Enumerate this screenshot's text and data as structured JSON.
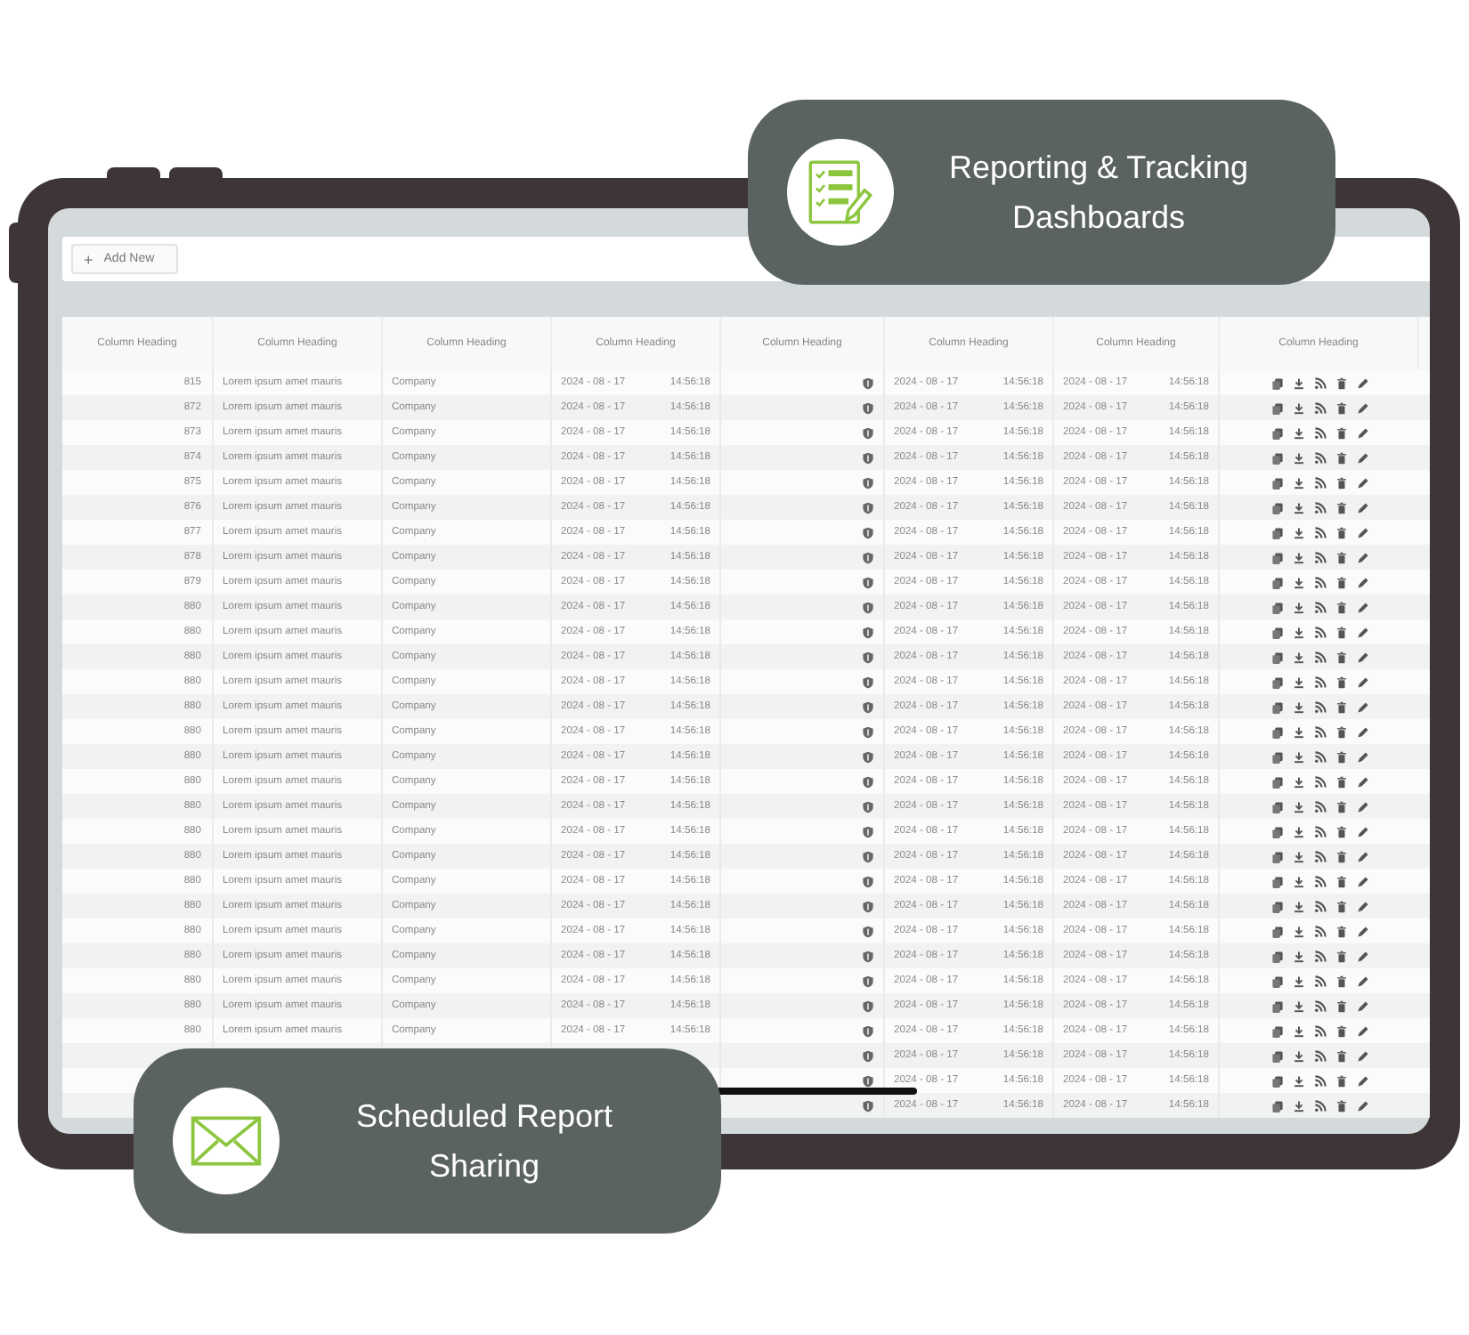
{
  "toolbar": {
    "add_button": {
      "icon": "+",
      "label": "Add New"
    }
  },
  "table": {
    "columns": [
      "Column Heading",
      "Column Heading",
      "Column Heading",
      "Column Heading",
      "Column Heading",
      "Column Heading",
      "Column Heading",
      "Column Heading"
    ],
    "rows": [
      {
        "number": "815",
        "description": "Lorem ipsum amet mauris",
        "company": "Company",
        "date_1": "2024 - 08 - 17",
        "time_1": "14:56:18",
        "date_2": "2024 - 08 - 17",
        "time_2": "14:56:18",
        "date_3": "2024 - 08 - 17",
        "time_3": "14:56:18"
      },
      {
        "number": "872",
        "description": "Lorem ipsum amet mauris",
        "company": "Company",
        "date_1": "2024 - 08 - 17",
        "time_1": "14:56:18",
        "date_2": "2024 - 08 - 17",
        "time_2": "14:56:18",
        "date_3": "2024 - 08 - 17",
        "time_3": "14:56:18"
      },
      {
        "number": "873",
        "description": "Lorem ipsum amet mauris",
        "company": "Company",
        "date_1": "2024 - 08 - 17",
        "time_1": "14:56:18",
        "date_2": "2024 - 08 - 17",
        "time_2": "14:56:18",
        "date_3": "2024 - 08 - 17",
        "time_3": "14:56:18"
      },
      {
        "number": "874",
        "description": "Lorem ipsum amet mauris",
        "company": "Company",
        "date_1": "2024 - 08 - 17",
        "time_1": "14:56:18",
        "date_2": "2024 - 08 - 17",
        "time_2": "14:56:18",
        "date_3": "2024 - 08 - 17",
        "time_3": "14:56:18"
      },
      {
        "number": "875",
        "description": "Lorem ipsum amet mauris",
        "company": "Company",
        "date_1": "2024 - 08 - 17",
        "time_1": "14:56:18",
        "date_2": "2024 - 08 - 17",
        "time_2": "14:56:18",
        "date_3": "2024 - 08 - 17",
        "time_3": "14:56:18"
      },
      {
        "number": "876",
        "description": "Lorem ipsum amet mauris",
        "company": "Company",
        "date_1": "2024 - 08 - 17",
        "time_1": "14:56:18",
        "date_2": "2024 - 08 - 17",
        "time_2": "14:56:18",
        "date_3": "2024 - 08 - 17",
        "time_3": "14:56:18"
      },
      {
        "number": "877",
        "description": "Lorem ipsum amet mauris",
        "company": "Company",
        "date_1": "2024 - 08 - 17",
        "time_1": "14:56:18",
        "date_2": "2024 - 08 - 17",
        "time_2": "14:56:18",
        "date_3": "2024 - 08 - 17",
        "time_3": "14:56:18"
      },
      {
        "number": "878",
        "description": "Lorem ipsum amet mauris",
        "company": "Company",
        "date_1": "2024 - 08 - 17",
        "time_1": "14:56:18",
        "date_2": "2024 - 08 - 17",
        "time_2": "14:56:18",
        "date_3": "2024 - 08 - 17",
        "time_3": "14:56:18"
      },
      {
        "number": "879",
        "description": "Lorem ipsum amet mauris",
        "company": "Company",
        "date_1": "2024 - 08 - 17",
        "time_1": "14:56:18",
        "date_2": "2024 - 08 - 17",
        "time_2": "14:56:18",
        "date_3": "2024 - 08 - 17",
        "time_3": "14:56:18"
      },
      {
        "number": "880",
        "description": "Lorem ipsum amet mauris",
        "company": "Company",
        "date_1": "2024 - 08 - 17",
        "time_1": "14:56:18",
        "date_2": "2024 - 08 - 17",
        "time_2": "14:56:18",
        "date_3": "2024 - 08 - 17",
        "time_3": "14:56:18"
      },
      {
        "number": "880",
        "description": "Lorem ipsum amet mauris",
        "company": "Company",
        "date_1": "2024 - 08 - 17",
        "time_1": "14:56:18",
        "date_2": "2024 - 08 - 17",
        "time_2": "14:56:18",
        "date_3": "2024 - 08 - 17",
        "time_3": "14:56:18"
      },
      {
        "number": "880",
        "description": "Lorem ipsum amet mauris",
        "company": "Company",
        "date_1": "2024 - 08 - 17",
        "time_1": "14:56:18",
        "date_2": "2024 - 08 - 17",
        "time_2": "14:56:18",
        "date_3": "2024 - 08 - 17",
        "time_3": "14:56:18"
      },
      {
        "number": "880",
        "description": "Lorem ipsum amet mauris",
        "company": "Company",
        "date_1": "2024 - 08 - 17",
        "time_1": "14:56:18",
        "date_2": "2024 - 08 - 17",
        "time_2": "14:56:18",
        "date_3": "2024 - 08 - 17",
        "time_3": "14:56:18"
      },
      {
        "number": "880",
        "description": "Lorem ipsum amet mauris",
        "company": "Company",
        "date_1": "2024 - 08 - 17",
        "time_1": "14:56:18",
        "date_2": "2024 - 08 - 17",
        "time_2": "14:56:18",
        "date_3": "2024 - 08 - 17",
        "time_3": "14:56:18"
      },
      {
        "number": "880",
        "description": "Lorem ipsum amet mauris",
        "company": "Company",
        "date_1": "2024 - 08 - 17",
        "time_1": "14:56:18",
        "date_2": "2024 - 08 - 17",
        "time_2": "14:56:18",
        "date_3": "2024 - 08 - 17",
        "time_3": "14:56:18"
      },
      {
        "number": "880",
        "description": "Lorem ipsum amet mauris",
        "company": "Company",
        "date_1": "2024 - 08 - 17",
        "time_1": "14:56:18",
        "date_2": "2024 - 08 - 17",
        "time_2": "14:56:18",
        "date_3": "2024 - 08 - 17",
        "time_3": "14:56:18"
      },
      {
        "number": "880",
        "description": "Lorem ipsum amet mauris",
        "company": "Company",
        "date_1": "2024 - 08 - 17",
        "time_1": "14:56:18",
        "date_2": "2024 - 08 - 17",
        "time_2": "14:56:18",
        "date_3": "2024 - 08 - 17",
        "time_3": "14:56:18"
      },
      {
        "number": "880",
        "description": "Lorem ipsum amet mauris",
        "company": "Company",
        "date_1": "2024 - 08 - 17",
        "time_1": "14:56:18",
        "date_2": "2024 - 08 - 17",
        "time_2": "14:56:18",
        "date_3": "2024 - 08 - 17",
        "time_3": "14:56:18"
      },
      {
        "number": "880",
        "description": "Lorem ipsum amet mauris",
        "company": "Company",
        "date_1": "2024 - 08 - 17",
        "time_1": "14:56:18",
        "date_2": "2024 - 08 - 17",
        "time_2": "14:56:18",
        "date_3": "2024 - 08 - 17",
        "time_3": "14:56:18"
      },
      {
        "number": "880",
        "description": "Lorem ipsum amet mauris",
        "company": "Company",
        "date_1": "2024 - 08 - 17",
        "time_1": "14:56:18",
        "date_2": "2024 - 08 - 17",
        "time_2": "14:56:18",
        "date_3": "2024 - 08 - 17",
        "time_3": "14:56:18"
      },
      {
        "number": "880",
        "description": "Lorem ipsum amet mauris",
        "company": "Company",
        "date_1": "2024 - 08 - 17",
        "time_1": "14:56:18",
        "date_2": "2024 - 08 - 17",
        "time_2": "14:56:18",
        "date_3": "2024 - 08 - 17",
        "time_3": "14:56:18"
      },
      {
        "number": "880",
        "description": "Lorem ipsum amet mauris",
        "company": "Company",
        "date_1": "2024 - 08 - 17",
        "time_1": "14:56:18",
        "date_2": "2024 - 08 - 17",
        "time_2": "14:56:18",
        "date_3": "2024 - 08 - 17",
        "time_3": "14:56:18"
      },
      {
        "number": "880",
        "description": "Lorem ipsum amet mauris",
        "company": "Company",
        "date_1": "2024 - 08 - 17",
        "time_1": "14:56:18",
        "date_2": "2024 - 08 - 17",
        "time_2": "14:56:18",
        "date_3": "2024 - 08 - 17",
        "time_3": "14:56:18"
      },
      {
        "number": "880",
        "description": "Lorem ipsum amet mauris",
        "company": "Company",
        "date_1": "2024 - 08 - 17",
        "time_1": "14:56:18",
        "date_2": "2024 - 08 - 17",
        "time_2": "14:56:18",
        "date_3": "2024 - 08 - 17",
        "time_3": "14:56:18"
      },
      {
        "number": "880",
        "description": "Lorem ipsum amet mauris",
        "company": "Company",
        "date_1": "2024 - 08 - 17",
        "time_1": "14:56:18",
        "date_2": "2024 - 08 - 17",
        "time_2": "14:56:18",
        "date_3": "2024 - 08 - 17",
        "time_3": "14:56:18"
      },
      {
        "number": "880",
        "description": "Lorem ipsum amet mauris",
        "company": "Company",
        "date_1": "2024 - 08 - 17",
        "time_1": "14:56:18",
        "date_2": "2024 - 08 - 17",
        "time_2": "14:56:18",
        "date_3": "2024 - 08 - 17",
        "time_3": "14:56:18"
      },
      {
        "number": "880",
        "description": "Lorem ipsum amet mauris",
        "company": "Company",
        "date_1": "2024 - 08 - 17",
        "time_1": "14:56:18",
        "date_2": "2024 - 08 - 17",
        "time_2": "14:56:18",
        "date_3": "2024 - 08 - 17",
        "time_3": "14:56:18"
      },
      {
        "date_2": "2024 - 08 - 17",
        "time_2": "14:56:18",
        "date_3": "2024 - 08 - 17",
        "time_3": "14:56:18"
      },
      {
        "date_2": "2024 - 08 - 17",
        "time_2": "14:56:18",
        "date_3": "2024 - 08 - 17",
        "time_3": "14:56:18"
      },
      {
        "date_2": "2024 - 08 - 17",
        "time_2": "14:56:18",
        "date_3": "2024 - 08 - 17",
        "time_3": "14:56:18"
      }
    ]
  },
  "callouts": [
    {
      "kind": "report",
      "lines": [
        "Reporting & Tracking",
        "Dashboards"
      ]
    },
    {
      "kind": "mail",
      "lines": [
        "Scheduled Report",
        "Sharing"
      ]
    }
  ]
}
